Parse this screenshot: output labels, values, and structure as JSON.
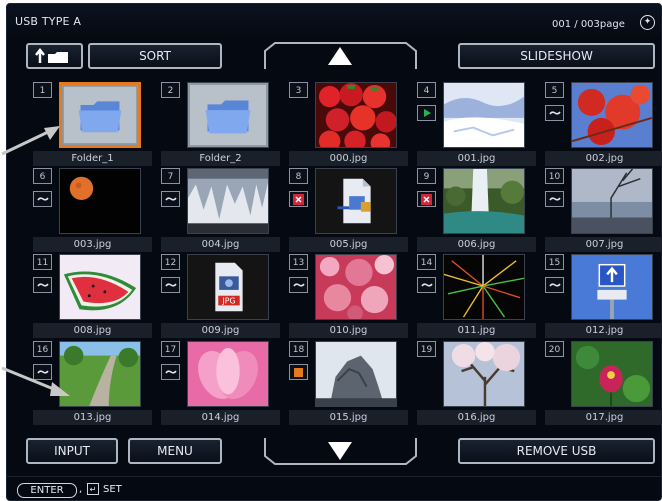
{
  "header": {
    "title": "USB TYPE A",
    "page": "001 / 003page",
    "nav_icon": "circle-nav-icon"
  },
  "controls": {
    "up_folder_icon": "up-folder-icon",
    "sort_label": "SORT",
    "slideshow_label": "SLIDESHOW",
    "input_label": "INPUT",
    "menu_label": "MENU",
    "remove_usb_label": "REMOVE USB"
  },
  "status": {
    "enter_label": "ENTER",
    "separator": ",",
    "set_label": "SET"
  },
  "colors": {
    "selection": "#e57a1c",
    "background": "#050a12",
    "caption_bg": "#1a2029",
    "badge_green": "#2bb24c",
    "badge_red": "#d0263a",
    "badge_orange": "#e57a1c"
  },
  "thumbnails": [
    {
      "num": "1",
      "name": "Folder_1",
      "badge": "none",
      "kind": "folder",
      "selected": true
    },
    {
      "num": "2",
      "name": "Folder_2",
      "badge": "none",
      "kind": "folder",
      "selected": false
    },
    {
      "num": "3",
      "name": "000.jpg",
      "badge": "none",
      "kind": "strawberries",
      "selected": false
    },
    {
      "num": "4",
      "name": "001.jpg",
      "badge": "play",
      "kind": "snow",
      "selected": false
    },
    {
      "num": "5",
      "name": "002.jpg",
      "badge": "tilde",
      "kind": "leaves",
      "selected": false
    },
    {
      "num": "6",
      "name": "003.jpg",
      "badge": "tilde",
      "kind": "moon",
      "selected": false
    },
    {
      "num": "7",
      "name": "004.jpg",
      "badge": "tilde",
      "kind": "icicles",
      "selected": false
    },
    {
      "num": "8",
      "name": "005.jpg",
      "badge": "error",
      "kind": "file",
      "selected": false
    },
    {
      "num": "9",
      "name": "006.jpg",
      "badge": "error",
      "kind": "waterfall",
      "selected": false
    },
    {
      "num": "10",
      "name": "007.jpg",
      "badge": "tilde",
      "kind": "sky",
      "selected": false
    },
    {
      "num": "11",
      "name": "008.jpg",
      "badge": "tilde",
      "kind": "watermelon",
      "selected": false
    },
    {
      "num": "12",
      "name": "009.jpg",
      "badge": "tilde",
      "kind": "jpgfile",
      "selected": false
    },
    {
      "num": "13",
      "name": "010.jpg",
      "badge": "tilde",
      "kind": "blossom",
      "selected": false
    },
    {
      "num": "14",
      "name": "011.jpg",
      "badge": "tilde",
      "kind": "fireworks",
      "selected": false
    },
    {
      "num": "15",
      "name": "012.jpg",
      "badge": "tilde",
      "kind": "sign",
      "selected": false
    },
    {
      "num": "16",
      "name": "013.jpg",
      "badge": "tilde",
      "kind": "road",
      "selected": false
    },
    {
      "num": "17",
      "name": "014.jpg",
      "badge": "tilde",
      "kind": "lotus",
      "selected": false
    },
    {
      "num": "18",
      "name": "015.jpg",
      "badge": "stop",
      "kind": "rock",
      "selected": false
    },
    {
      "num": "19",
      "name": "016.jpg",
      "badge": "none",
      "kind": "tree",
      "selected": false
    },
    {
      "num": "20",
      "name": "017.jpg",
      "badge": "none",
      "kind": "flower",
      "selected": false
    }
  ]
}
